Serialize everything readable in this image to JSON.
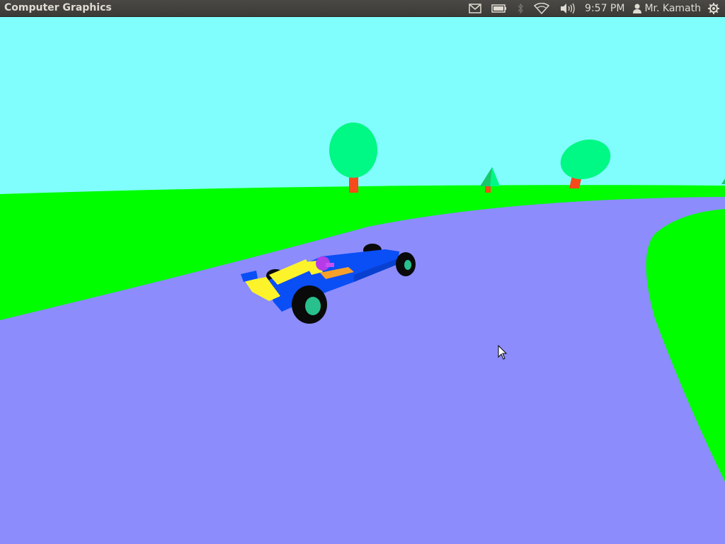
{
  "topbar": {
    "app_title": "Computer Graphics",
    "clock": "9:57 PM",
    "user_name": "Mr. Kamath"
  },
  "indicators": {
    "icons": [
      "mail-icon",
      "battery-icon",
      "bluetooth-icon",
      "wifi-icon",
      "volume-icon",
      "user-icon",
      "power-gear-icon"
    ]
  },
  "scene": {
    "sky_color": "#80fdfd",
    "grass_color": "#00fd00",
    "road_color": "#8c8cfd",
    "tree_foliage_color": "#00f884",
    "tree_trunk_color": "#f64a1a",
    "car_body_color": "#0a4ef5",
    "car_wing_color": "#fdf32a",
    "helmet_color": "#b63ae8",
    "wheel_color": "#0a0a0a",
    "hub_color": "#28c08c"
  }
}
